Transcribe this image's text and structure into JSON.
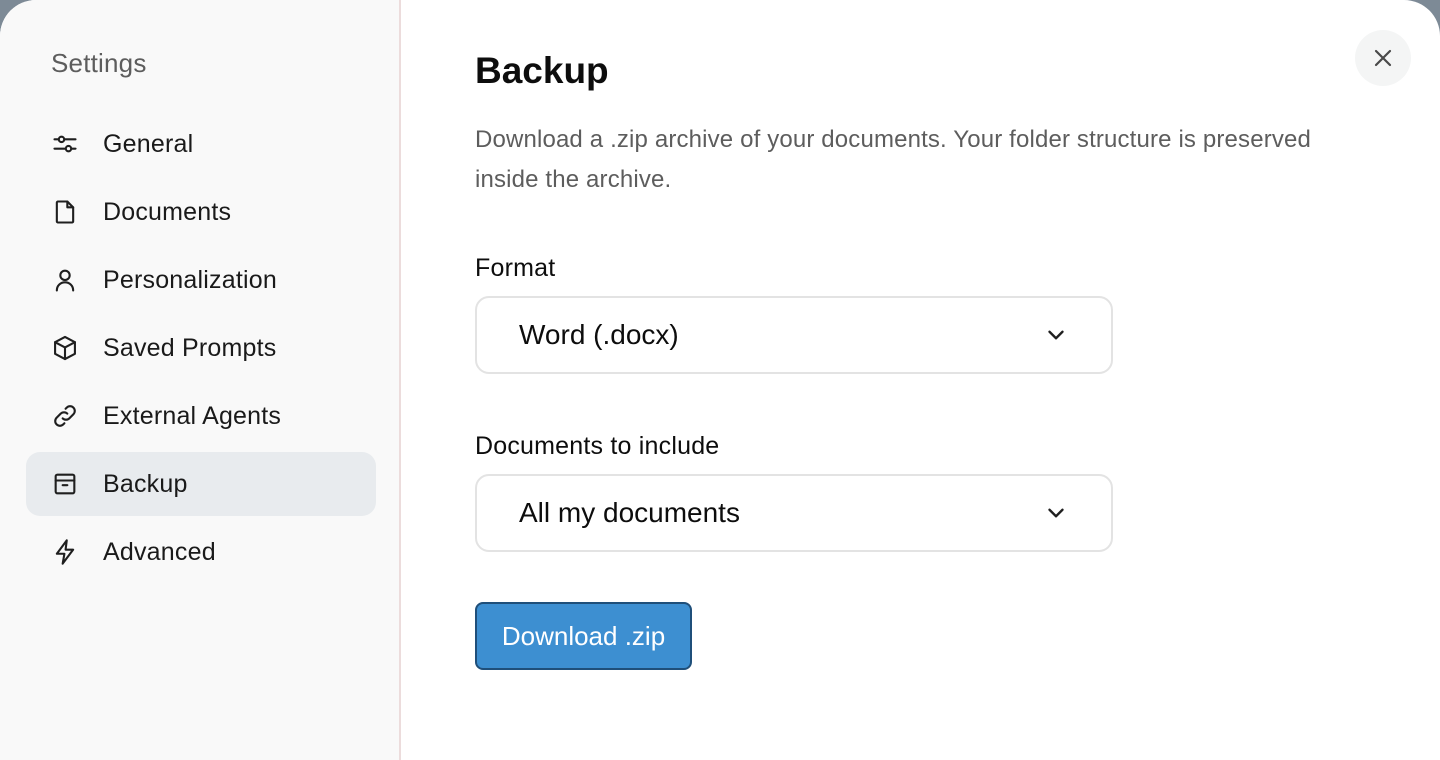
{
  "sidebar": {
    "title": "Settings",
    "items": [
      {
        "label": "General",
        "icon": "sliders-icon",
        "active": false
      },
      {
        "label": "Documents",
        "icon": "document-icon",
        "active": false
      },
      {
        "label": "Personalization",
        "icon": "user-icon",
        "active": false
      },
      {
        "label": "Saved Prompts",
        "icon": "cube-icon",
        "active": false
      },
      {
        "label": "External Agents",
        "icon": "link-icon",
        "active": false
      },
      {
        "label": "Backup",
        "icon": "archive-icon",
        "active": true
      },
      {
        "label": "Advanced",
        "icon": "lightning-icon",
        "active": false
      }
    ]
  },
  "main": {
    "title": "Backup",
    "description": "Download a .zip archive of your documents. Your folder structure is preserved inside the archive.",
    "format": {
      "label": "Format",
      "value": "Word (.docx)"
    },
    "scope": {
      "label": "Documents to include",
      "value": "All my documents"
    },
    "download_label": "Download .zip"
  },
  "colors": {
    "accent": "#3d8fd1",
    "active_nav": "#e8ebee",
    "sidebar_bg": "#f9f9f9"
  }
}
